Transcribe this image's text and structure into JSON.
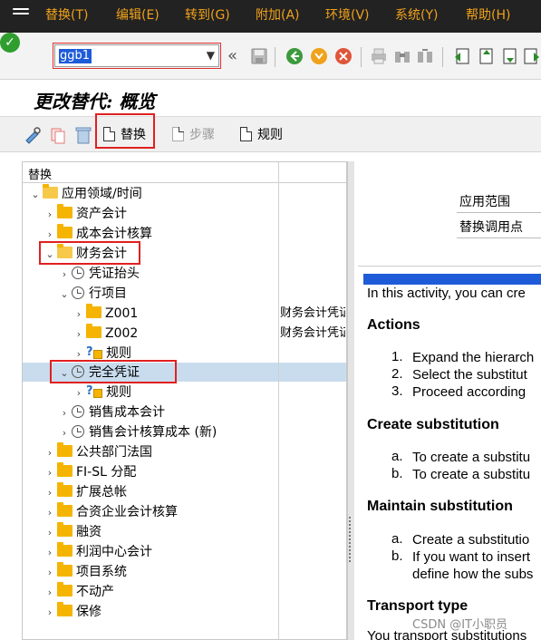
{
  "menu": [
    "替换(T)",
    "编辑(E)",
    "转到(G)",
    "附加(A)",
    "环境(V)",
    "系统(Y)",
    "帮助(H)"
  ],
  "toolbar": {
    "command_value": "ggb1",
    "back_glyph": "«"
  },
  "page_title": "更改替代: 概览",
  "app_toolbar": {
    "replace_label": "替换",
    "step_label": "步骤",
    "rule_label": "规则"
  },
  "tree": {
    "header": "替换",
    "nodes": [
      {
        "label": "应用领域/时间",
        "expanded": true,
        "icon": "folder-open-icon"
      },
      {
        "label": "资产会计",
        "icon": "folder-icon"
      },
      {
        "label": "成本会计核算",
        "icon": "folder-icon"
      },
      {
        "label": "财务会计",
        "expanded": true,
        "icon": "folder-open-icon"
      },
      {
        "label": "凭证抬头",
        "icon": "clock-icon"
      },
      {
        "label": "行项目",
        "expanded": true,
        "icon": "clock-icon"
      },
      {
        "label": "Z001",
        "icon": "folder-icon",
        "desc": "财务会计凭证"
      },
      {
        "label": "Z002",
        "icon": "folder-icon",
        "desc": "财务会计凭证"
      },
      {
        "label": "规则",
        "icon": "rule-icon"
      },
      {
        "label": "完全凭证",
        "expanded": true,
        "icon": "clock-icon",
        "selected": true
      },
      {
        "label": "规则",
        "icon": "rule-icon"
      },
      {
        "label": "销售成本会计",
        "icon": "clock-icon"
      },
      {
        "label": "销售会计核算成本 (新)",
        "icon": "clock-icon"
      },
      {
        "label": "公共部门法国",
        "icon": "folder-icon"
      },
      {
        "label": "FI-SL 分配",
        "icon": "folder-icon"
      },
      {
        "label": "扩展总帐",
        "icon": "folder-icon"
      },
      {
        "label": "合资企业会计核算",
        "icon": "folder-icon"
      },
      {
        "label": "融资",
        "icon": "folder-icon"
      },
      {
        "label": "利润中心会计",
        "icon": "folder-icon"
      },
      {
        "label": "项目系统",
        "icon": "folder-icon"
      },
      {
        "label": "不动产",
        "icon": "folder-icon"
      },
      {
        "label": "保修",
        "icon": "folder-icon"
      }
    ]
  },
  "right": {
    "field1_label": "应用范围",
    "field2_label": "替换调用点",
    "doc": {
      "intro": "In this activity, you can cre",
      "actions_heading": "Actions",
      "actions": [
        "Expand the hierarch",
        "Select the substitut",
        "Proceed according"
      ],
      "create_heading": "Create substitution",
      "create_items": [
        "To create a substitu",
        "To create a substitu"
      ],
      "maintain_heading": "Maintain substitution",
      "maintain_items": [
        "Create a substitutio",
        "If you want to insert",
        "define how the subs"
      ],
      "transport_heading": "Transport type",
      "transport_text": "You transport substitutions"
    }
  },
  "watermark": "CSDN @IT小职员"
}
